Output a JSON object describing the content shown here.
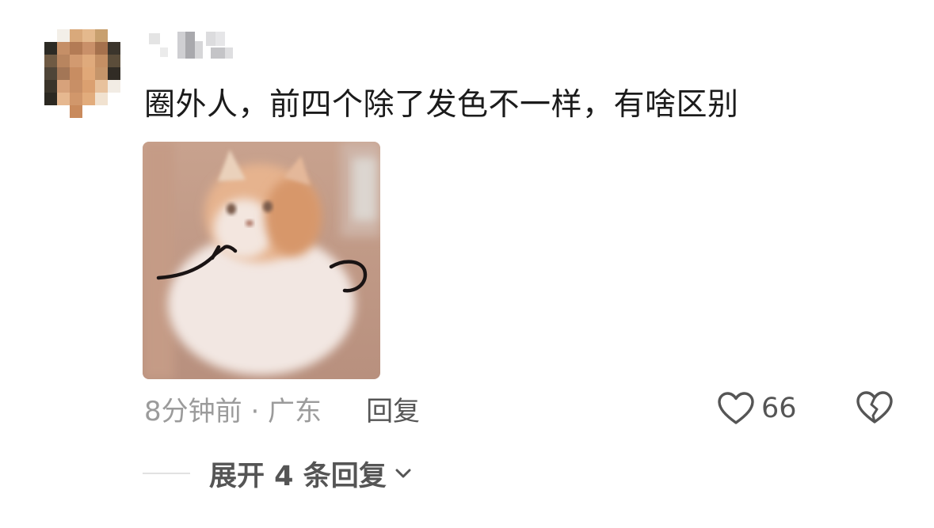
{
  "comment": {
    "avatar_icon": "pixelated-avatar",
    "username": "",
    "text": "圈外人，前四个除了发色不一样，有啥区别",
    "image_icon": "cat-meme-image",
    "time_location": "8分钟前 · 广东",
    "reply_label": "回复",
    "like_icon": "heart-outline-icon",
    "like_count": "66",
    "dislike_icon": "broken-heart-icon"
  },
  "replies": {
    "expand_label": "展开 4 条回复",
    "expand_icon": "chevron-down-icon"
  }
}
